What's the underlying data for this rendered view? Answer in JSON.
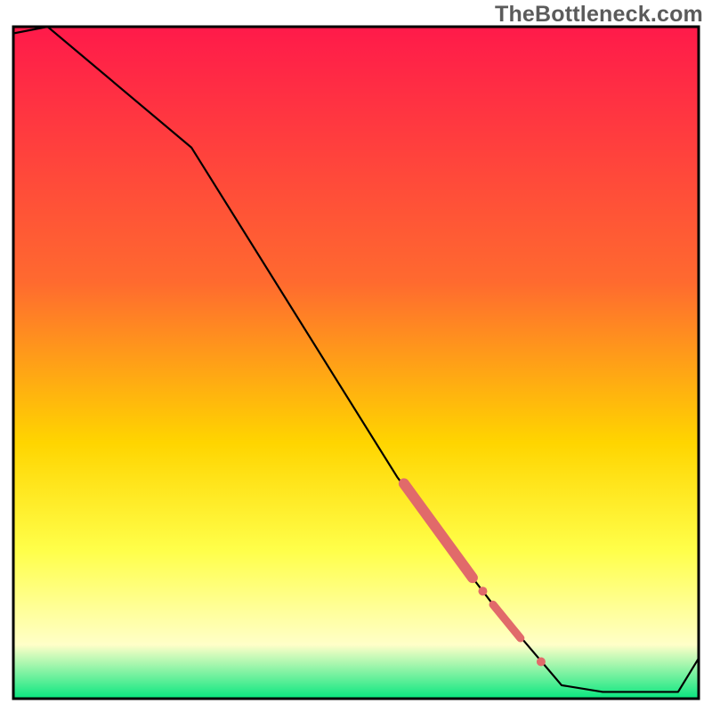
{
  "watermark": "TheBottleneck.com",
  "colors": {
    "black": "#000000",
    "marker": "#e16a6a",
    "grad_top": "#ff1a4a",
    "grad_mid1": "#ff6a2f",
    "grad_mid2": "#ffd500",
    "grad_mid3": "#ffff4a",
    "grad_mid4": "#ffffc8",
    "grad_bottom": "#08e67f"
  },
  "chart_data": {
    "type": "line",
    "title": "",
    "xlabel": "",
    "ylabel": "",
    "xlim": [
      0,
      100
    ],
    "ylim": [
      0,
      100
    ],
    "grid": false,
    "legend": false,
    "line": {
      "x": [
        0,
        5,
        26,
        56,
        67,
        70,
        80,
        86,
        92,
        97,
        100
      ],
      "y": [
        99,
        100,
        82,
        33,
        18,
        14,
        2,
        1,
        1,
        1,
        6
      ]
    },
    "markers": [
      {
        "kind": "segment",
        "x0": 57,
        "y0": 32,
        "x1": 67,
        "y1": 18,
        "width": 12
      },
      {
        "kind": "dot",
        "x": 68.5,
        "y": 16,
        "r": 5
      },
      {
        "kind": "segment",
        "x0": 70,
        "y0": 14,
        "x1": 74,
        "y1": 9,
        "width": 9
      },
      {
        "kind": "dot",
        "x": 77,
        "y": 5.5,
        "r": 5
      }
    ]
  }
}
